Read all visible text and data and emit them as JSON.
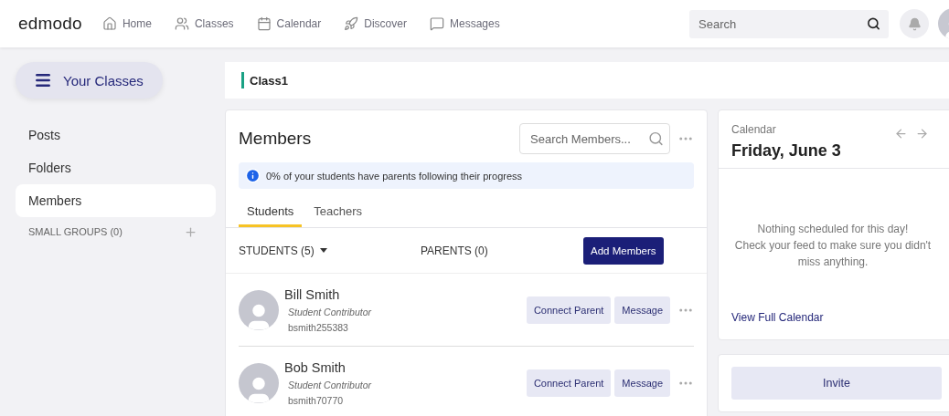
{
  "topbar": {
    "logo": "edmodo",
    "nav": [
      {
        "kind": "home",
        "label": "Home"
      },
      {
        "kind": "classes",
        "label": "Classes"
      },
      {
        "kind": "calendar",
        "label": "Calendar"
      },
      {
        "kind": "discover",
        "label": "Discover"
      },
      {
        "kind": "messages",
        "label": "Messages"
      }
    ],
    "search": {
      "placeholder": "Search"
    }
  },
  "sidebar": {
    "button": "Your Classes",
    "items": [
      {
        "label": "Posts",
        "selected": false
      },
      {
        "label": "Folders",
        "selected": false
      },
      {
        "label": "Members",
        "selected": true
      }
    ],
    "groups": "SMALL GROUPS (0)"
  },
  "class_header": "Class1",
  "members": {
    "title": "Members",
    "search": {
      "placeholder": "Search Members..."
    },
    "notice": "0% of your students have parents following their progress",
    "tabs": [
      {
        "label": "Students",
        "selected": true
      },
      {
        "label": "Teachers",
        "selected": false
      }
    ],
    "students_filter": "STUDENTS (5)",
    "parents_count": "PARENTS (0)",
    "add_button": "Add Members",
    "rows": [
      {
        "name": "Bill Smith",
        "role": "Student Contributor",
        "username": "bsmith255383",
        "actions": [
          "Connect Parent",
          "Message"
        ]
      },
      {
        "name": "Bob Smith",
        "role": "Student Contributor",
        "username": "bsmith70770",
        "actions": [
          "Connect Parent",
          "Message"
        ]
      }
    ]
  },
  "calendar": {
    "label": "Calendar",
    "date": "Friday, June 3",
    "empty_lines": [
      "Nothing scheduled for this day!",
      "Check your feed to make sure you didn't",
      "miss anything."
    ],
    "link": "View Full Calendar"
  },
  "invite_button": "Invite"
}
